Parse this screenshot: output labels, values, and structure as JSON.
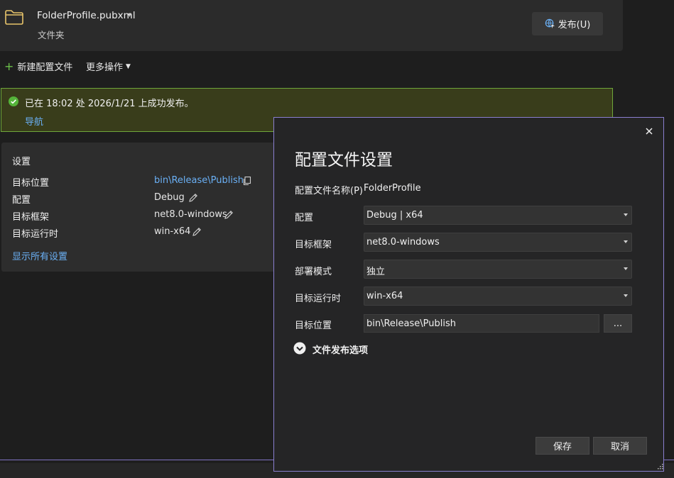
{
  "header": {
    "profile_name": "FolderProfile.pubxml",
    "profile_type": "文件夹",
    "publish_button": "发布(U)"
  },
  "toolbar": {
    "new_profile": "新建配置文件",
    "more_actions": "更多操作"
  },
  "banner": {
    "message": "已在 18:02 处 2026/1/21 上成功发布。",
    "link": "导航"
  },
  "settings": {
    "title": "设置",
    "rows": [
      {
        "label": "目标位置",
        "value": "bin\\Release\\Publish"
      },
      {
        "label": "配置",
        "value": "Debug"
      },
      {
        "label": "目标框架",
        "value": "net8.0-windows"
      },
      {
        "label": "目标运行时",
        "value": "win-x64"
      }
    ],
    "show_all": "显示所有设置"
  },
  "dialog": {
    "title": "配置文件设置",
    "profile_name_label": "配置文件名称(P)",
    "profile_name_value": "FolderProfile",
    "fields": [
      {
        "label": "配置",
        "value": "Debug | x64"
      },
      {
        "label": "目标框架",
        "value": "net8.0-windows"
      },
      {
        "label": "部署模式",
        "value": "独立"
      },
      {
        "label": "目标运行时",
        "value": "win-x64"
      }
    ],
    "target_location_label": "目标位置",
    "target_location_value": "bin\\Release\\Publish",
    "browse_label": "...",
    "section_label": "文件发布选项",
    "save_button": "保存",
    "cancel_button": "取消"
  },
  "colors": {
    "accent_link": "#6ab0f5",
    "success_border": "#6ea63a",
    "success_bg": "#393d1b",
    "dialog_border": "#8a7fd0"
  }
}
